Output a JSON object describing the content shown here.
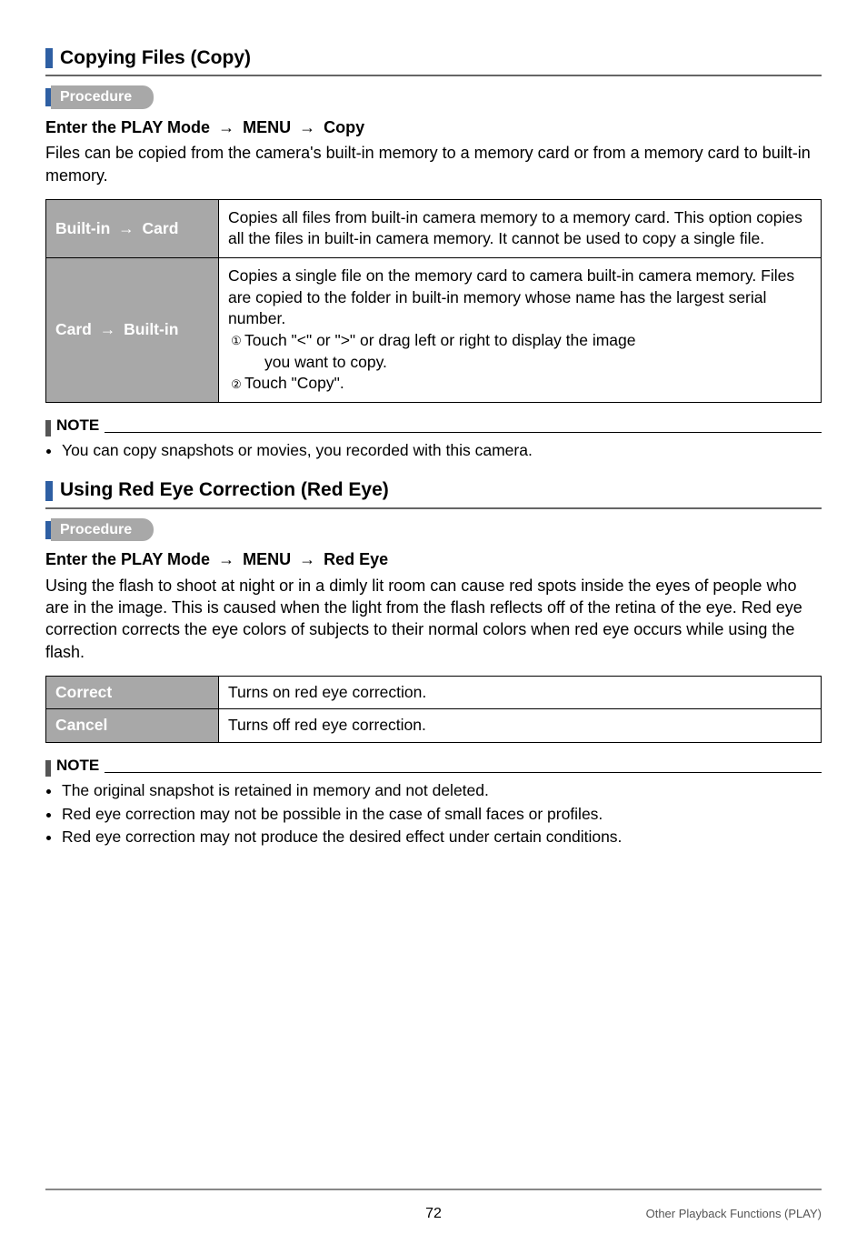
{
  "sections": {
    "copy": {
      "title": "Copying Files (Copy)",
      "procedure_label": "Procedure",
      "subhead_prefix": "Enter the PLAY Mode",
      "subhead_mid": "MENU",
      "subhead_end": "Copy",
      "intro": "Files can be copied from the camera's built-in memory to a memory card or from a memory card to built-in memory.",
      "rows": [
        {
          "label_a": "Built-in",
          "label_b": "Card",
          "desc": "Copies all files from built-in camera memory to a memory card. This option copies all the files in built-in camera memory. It cannot be used to copy a single file."
        },
        {
          "label_a": "Card",
          "label_b": "Built-in",
          "desc_line1": "Copies a single file on the memory card to camera built-in camera memory. Files are copied to the folder in built-in memory whose name has the largest serial number.",
          "step1": "Touch \"<\" or \">\" or drag left or right to display the image",
          "step1_cont": "you want to copy.",
          "step2": "Touch \"Copy\"."
        }
      ],
      "note_label": "NOTE",
      "notes": [
        "You can copy snapshots or movies, you recorded with this camera."
      ]
    },
    "redeye": {
      "title": "Using Red Eye Correction (Red Eye)",
      "procedure_label": "Procedure",
      "subhead_prefix": "Enter the PLAY Mode",
      "subhead_mid": "MENU",
      "subhead_end": "Red Eye",
      "intro": "Using the flash to shoot at night or in a dimly lit room can cause red spots inside the eyes of people who are in the image. This is caused when the light from the flash reflects off of the retina of the eye. Red eye correction corrects the eye colors of subjects to their normal colors when red eye occurs while using the flash.",
      "rows": [
        {
          "label": "Correct",
          "desc": "Turns on red eye correction."
        },
        {
          "label": "Cancel",
          "desc": "Turns off red eye correction."
        }
      ],
      "note_label": "NOTE",
      "notes": [
        "The original snapshot is retained in memory and not deleted.",
        "Red eye correction may not be possible in the case of small faces or profiles.",
        "Red eye correction may not produce the desired effect under certain conditions."
      ]
    }
  },
  "footer": {
    "page_number": "72",
    "section_label": "Other Playback Functions (PLAY)"
  },
  "glyphs": {
    "arrow": "→",
    "lt": "<",
    "gt": ">",
    "c1": "①",
    "c2": "②"
  }
}
